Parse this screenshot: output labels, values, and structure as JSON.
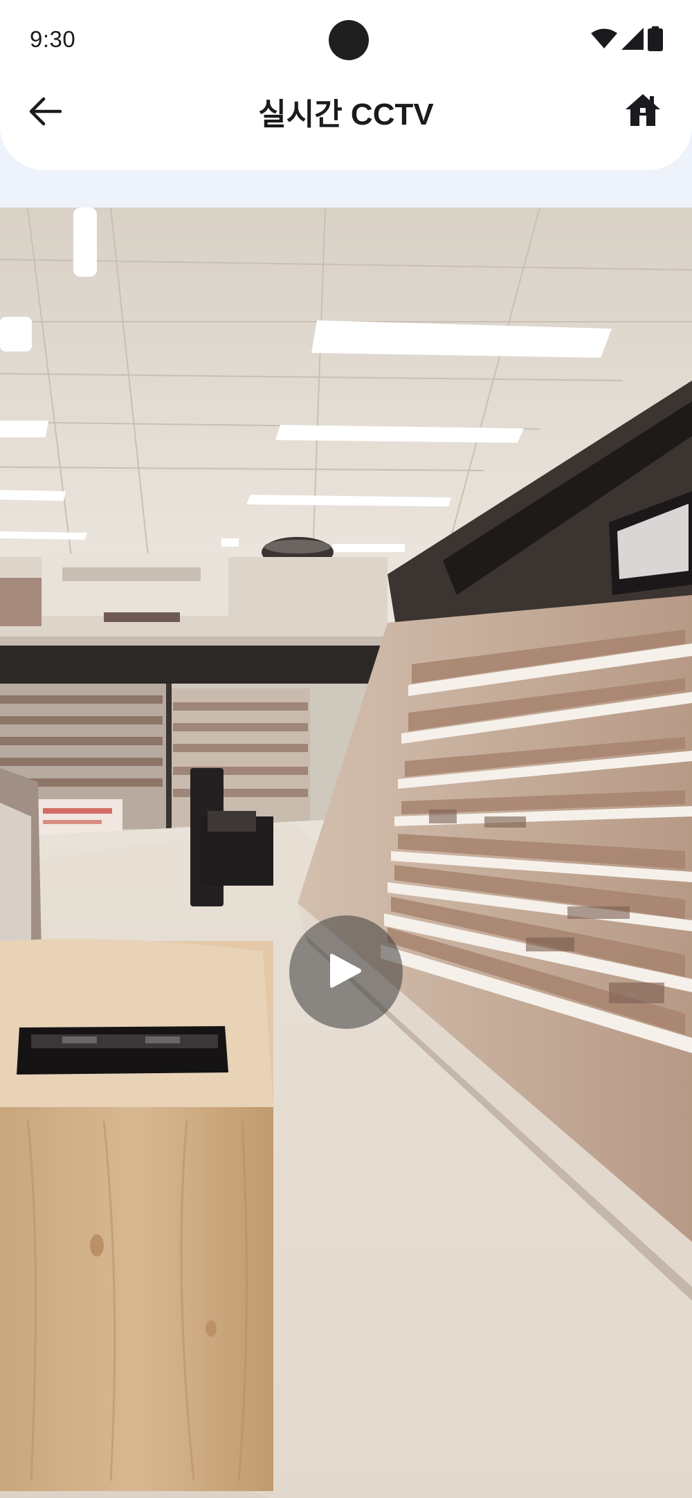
{
  "status_bar": {
    "time": "9:30",
    "icons": [
      "wifi-icon",
      "cellular-signal-icon",
      "battery-icon"
    ]
  },
  "app_bar": {
    "title": "실시간 CCTV",
    "back_icon": "arrow-left-icon",
    "home_icon": "home-icon"
  },
  "video": {
    "description_icon": "play-icon",
    "state": "paused"
  },
  "colors": {
    "background": "#eef2fb",
    "header": "#ffffff",
    "text": "#1b1b1f",
    "play_overlay": "#3c3c3c"
  }
}
